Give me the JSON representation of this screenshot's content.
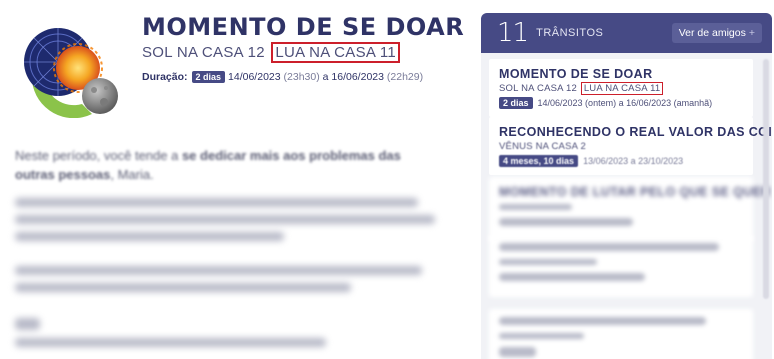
{
  "transit": {
    "title": "MOMENTO DE SE DOAR",
    "subtitle_prefix": "SOL NA CASA 12",
    "subtitle_highlight": "LUA NA CASA 11",
    "duration_label": "Duração:",
    "duration_badge": "2 dias",
    "start_date": "14/06/2023",
    "start_time": "(23h30)",
    "separator": "a",
    "end_date": "16/06/2023",
    "end_time": "(22h29)"
  },
  "body": {
    "intro_prefix": "Neste período, você tende a ",
    "intro_bold": "se dedicar mais aos problemas das outras pessoas",
    "intro_suffix": ", Maria."
  },
  "panel": {
    "count": "11",
    "label": "TRÂNSITOS",
    "friends_button": "Ver de amigos",
    "friends_icon": "plus-icon",
    "items": [
      {
        "title": "MOMENTO DE SE DOAR",
        "sub_prefix": "SOL NA CASA 12",
        "sub_highlight": "LUA NA CASA 11",
        "badge": "2 dias",
        "dates": "14/06/2023 (ontem) a 16/06/2023 (amanhã)"
      },
      {
        "title": "RECONHECENDO O REAL VALOR DAS COISAS",
        "sub": "VÊNUS NA CASA 2",
        "badge": "4 meses, 10 dias",
        "dates": "13/06/2023 a 23/10/2023"
      },
      {
        "title": "MOMENTO DE LUTAR PELO QUE SE QUER"
      }
    ]
  },
  "colors": {
    "navy": "#2f3366",
    "accent": "#464a85",
    "highlight_border": "#cc1f2b"
  }
}
